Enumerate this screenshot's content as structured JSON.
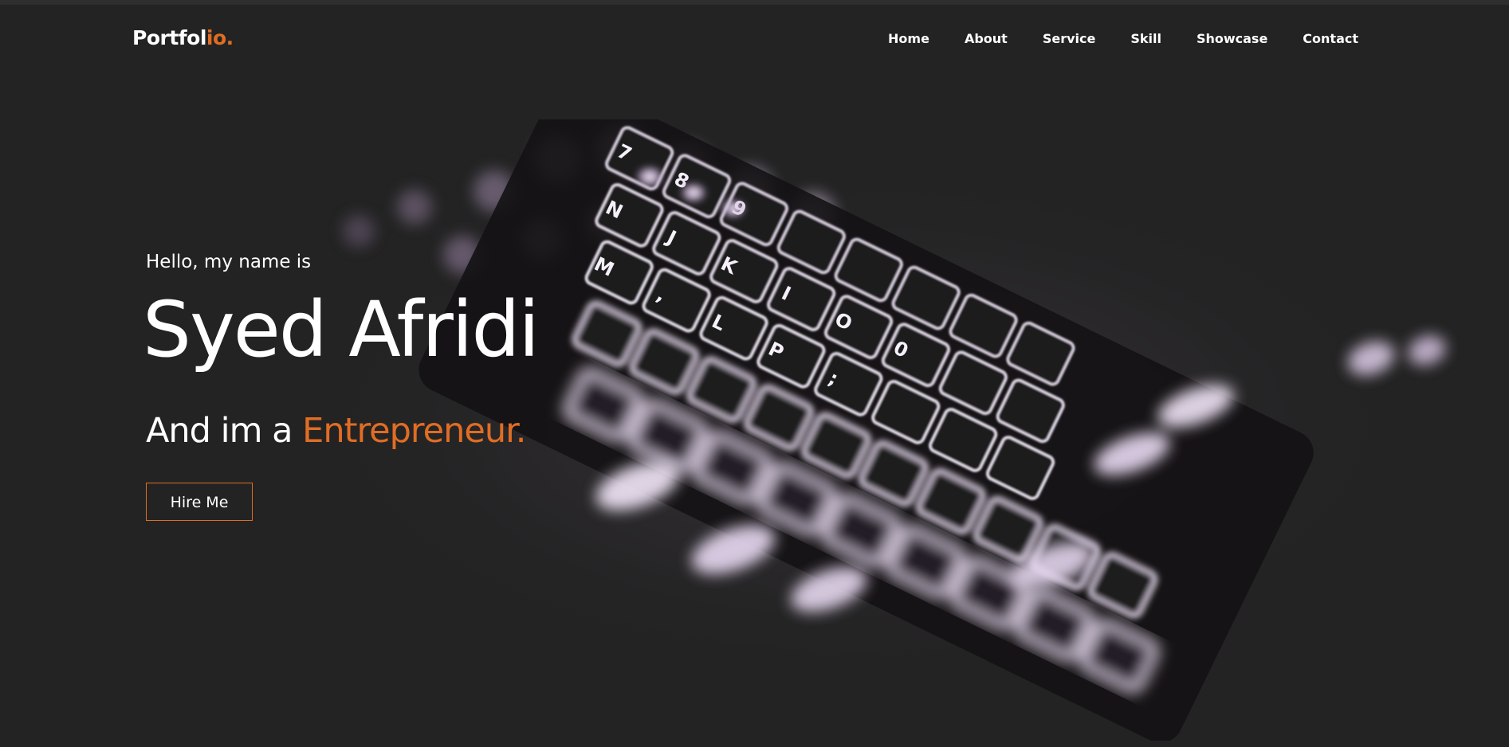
{
  "brand": {
    "logo_main": "Portfol",
    "logo_accent": "io."
  },
  "nav": {
    "items": [
      {
        "label": "Home"
      },
      {
        "label": "About"
      },
      {
        "label": "Service"
      },
      {
        "label": "Skill"
      },
      {
        "label": "Showcase"
      },
      {
        "label": "Contact"
      }
    ]
  },
  "hero": {
    "greeting": "Hello, my name is",
    "name": "Syed Afridi",
    "role_prefix": "And im a ",
    "role_highlight": "Entrepreneur.",
    "cta_label": "Hire Me",
    "background_image": "illuminated-keyboard-image"
  },
  "colors": {
    "background": "#232323",
    "accent": "#e06d24",
    "text": "#ffffff"
  }
}
